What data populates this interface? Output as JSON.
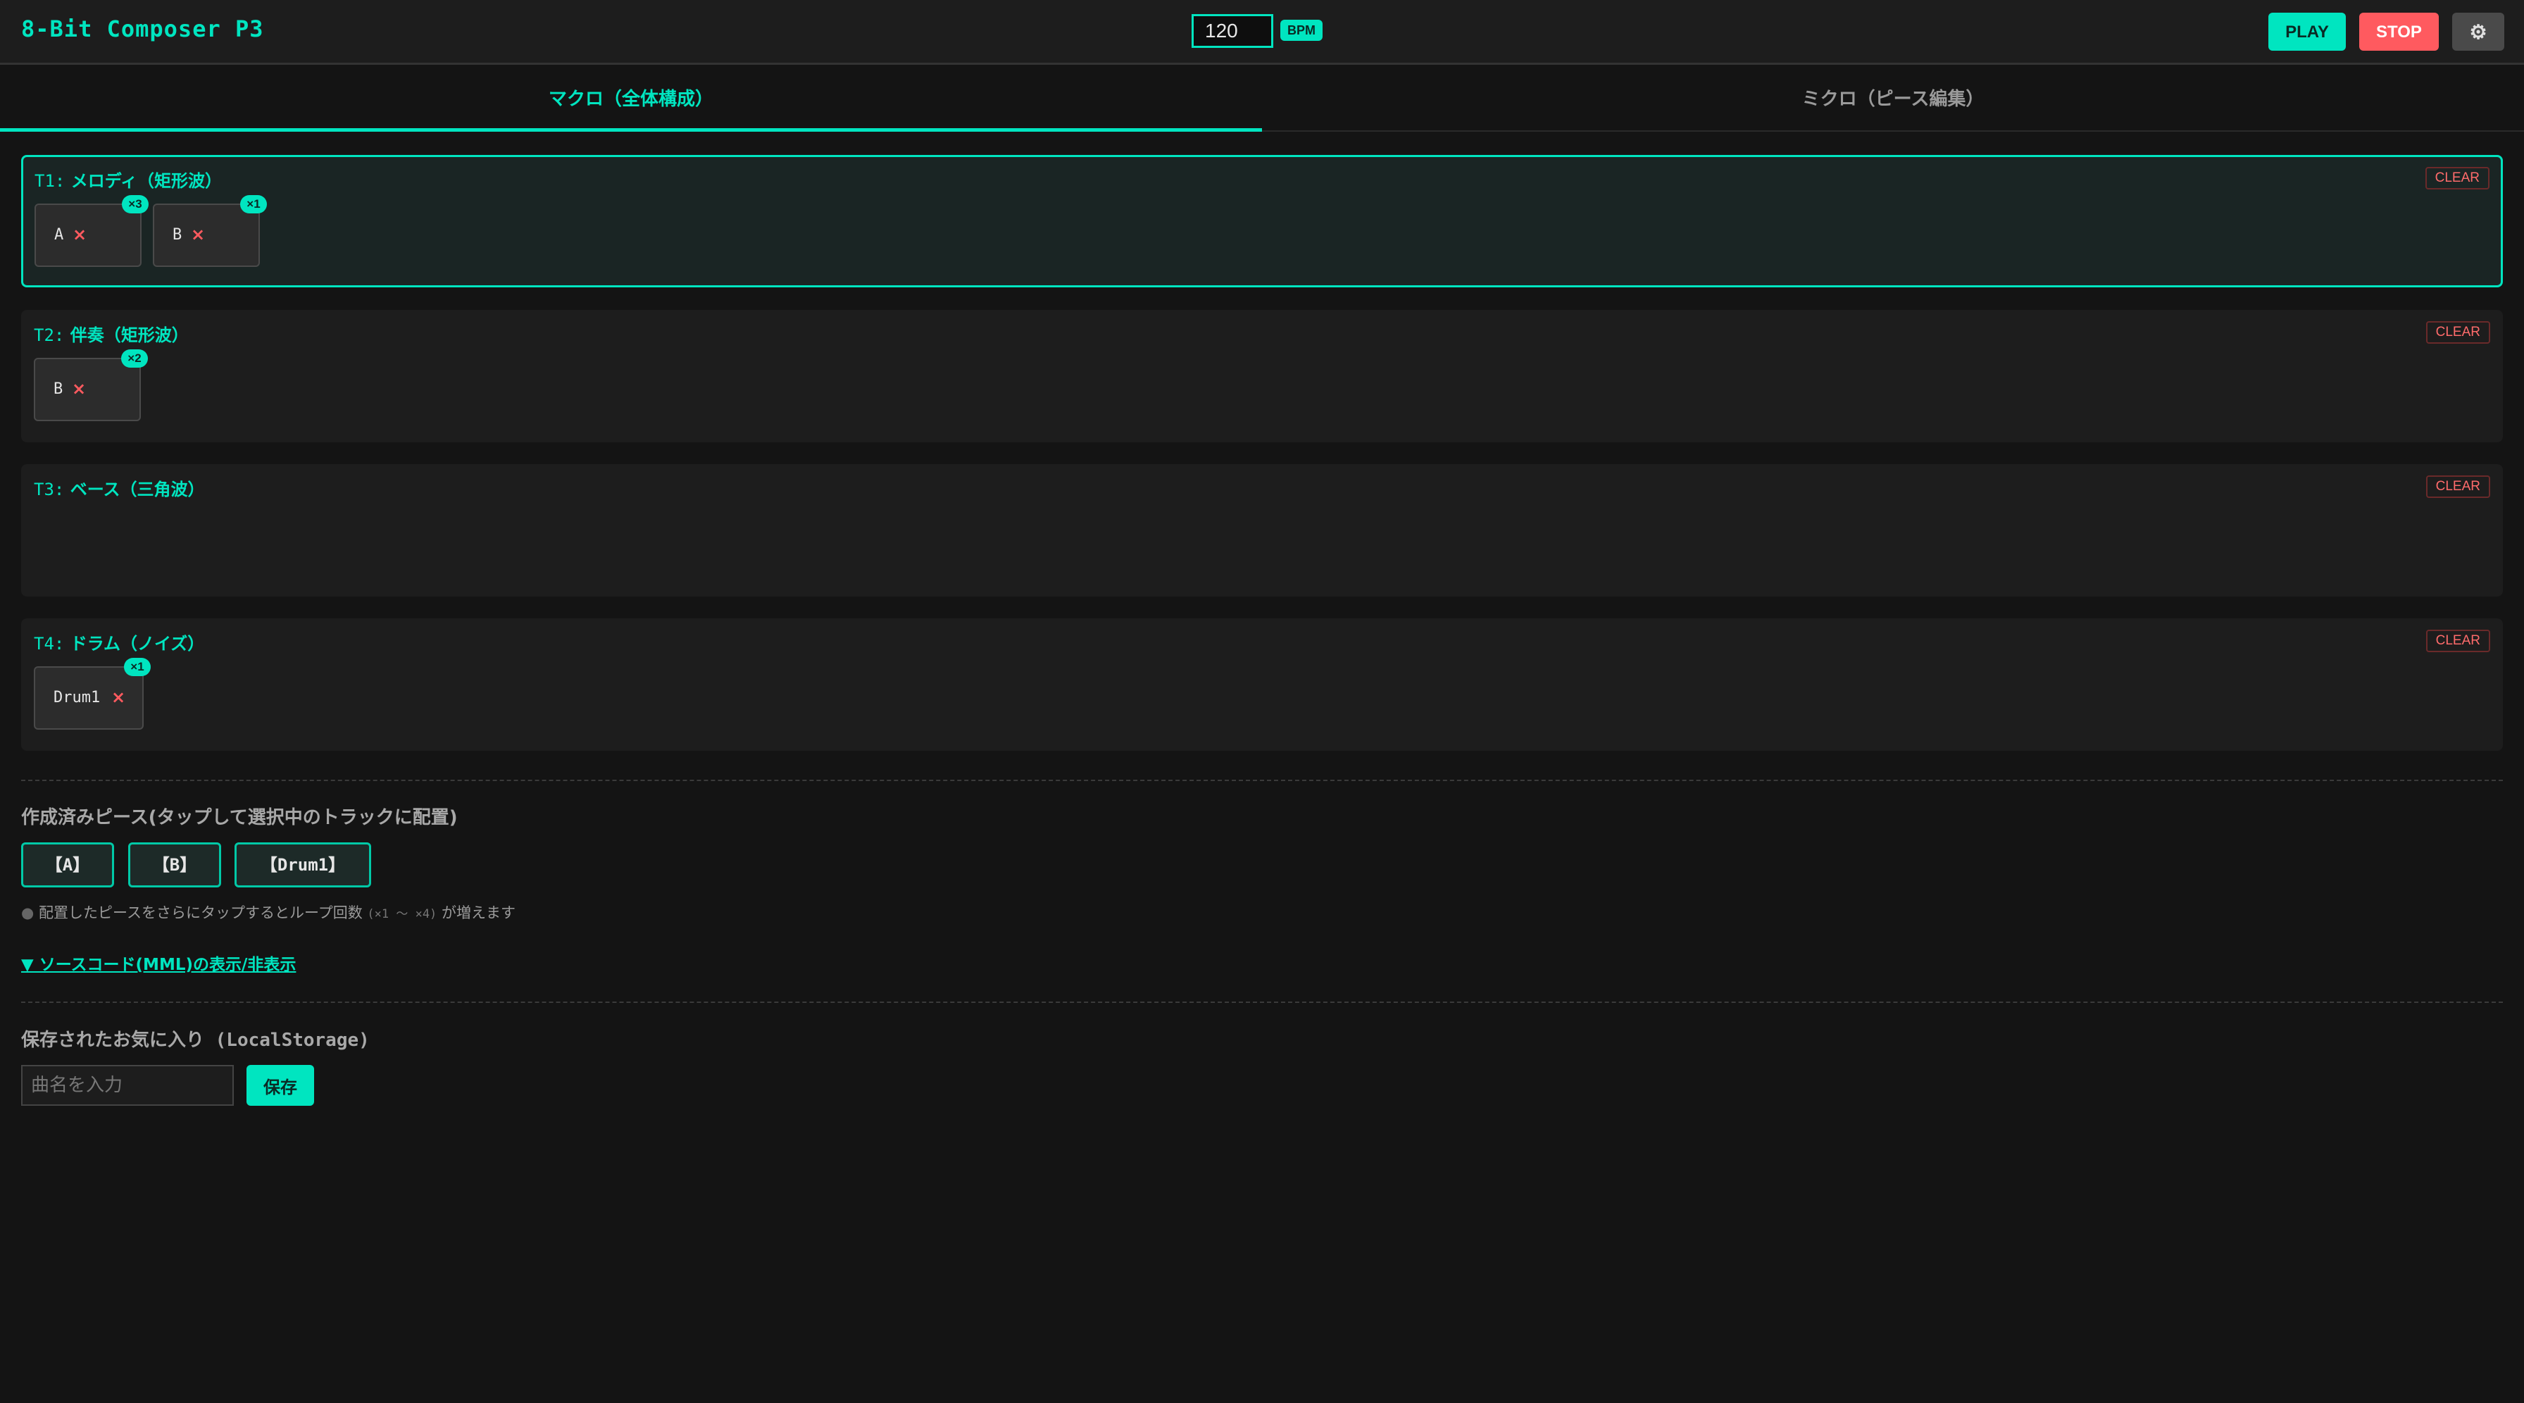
{
  "header": {
    "title": "8-Bit Composer P3",
    "bpm_value": "120",
    "bpm_label": "BPM",
    "play_label": "PLAY",
    "stop_label": "STOP",
    "settings_icon": "⚙"
  },
  "tabs": [
    {
      "label": "マクロ（全体構成）",
      "active": true
    },
    {
      "label": "ミクロ（ピース編集）",
      "active": false
    }
  ],
  "tracks": [
    {
      "id": "T1:",
      "name": "メロディ（矩形波）",
      "clear_label": "CLEAR",
      "selected": true,
      "pieces": [
        {
          "name": "A",
          "remove": "×",
          "loops": "×3"
        },
        {
          "name": "B",
          "remove": "×",
          "loops": "×1"
        }
      ]
    },
    {
      "id": "T2:",
      "name": "伴奏（矩形波）",
      "clear_label": "CLEAR",
      "selected": false,
      "pieces": [
        {
          "name": "B",
          "remove": "×",
          "loops": "×2"
        }
      ]
    },
    {
      "id": "T3:",
      "name": "ベース（三角波）",
      "clear_label": "CLEAR",
      "selected": false,
      "pieces": []
    },
    {
      "id": "T4:",
      "name": "ドラム（ノイズ）",
      "clear_label": "CLEAR",
      "selected": false,
      "pieces": [
        {
          "name": "Drum1",
          "remove": "×",
          "loops": "×1"
        }
      ]
    }
  ],
  "library": {
    "title": "作成済みピース(タップして選択中のトラックに配置)",
    "pieces": [
      "【A】",
      "【B】",
      "【Drum1】"
    ],
    "hint_dot": "●",
    "hint_text": "配置したピースをさらにタップするとループ回数",
    "hint_range": "(×1 〜 ×4)",
    "hint_suffix": "が増えます",
    "mml_toggle": "▼ ソースコード(MML)の表示/非表示"
  },
  "favorites": {
    "title": "保存されたお気に入り (LocalStorage)",
    "input_placeholder": "曲名を入力",
    "save_label": "保存"
  },
  "colors": {
    "accent": "#00e5c0",
    "danger": "#ff5a5f",
    "background": "#141414"
  }
}
